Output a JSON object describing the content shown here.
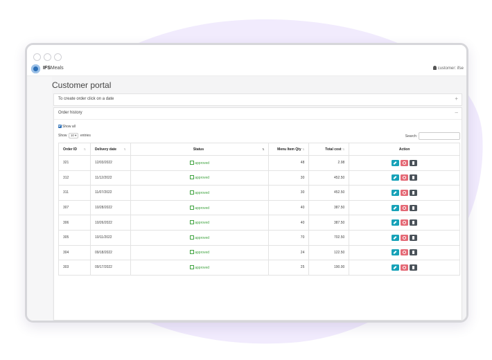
{
  "app": {
    "brand_strong": "IFS",
    "brand_rest": "Meals",
    "user": "customer: ifse"
  },
  "page": {
    "title": "Customer portal"
  },
  "create_card": {
    "title": "To create order click on a date",
    "tool": "+"
  },
  "history_card": {
    "title": "Order history",
    "tool": "–",
    "show_all": "Show all",
    "show_prefix": "Show",
    "entries_value": "10",
    "show_suffix": "entries",
    "search_label": "Search:"
  },
  "table": {
    "columns": [
      "Order ID",
      "Delivery date",
      "Status",
      "Menu Item Qty",
      "Total cost",
      "Action"
    ],
    "rows": [
      {
        "id": "321",
        "date": "12/03/2022",
        "status": "approved",
        "qty": "48",
        "cost": "2.98"
      },
      {
        "id": "312",
        "date": "11/12/2022",
        "status": "approved",
        "qty": "30",
        "cost": "452.50"
      },
      {
        "id": "311",
        "date": "11/07/2022",
        "status": "approved",
        "qty": "30",
        "cost": "452.50"
      },
      {
        "id": "307",
        "date": "10/28/2022",
        "status": "approved",
        "qty": "40",
        "cost": "387.50"
      },
      {
        "id": "306",
        "date": "10/26/2022",
        "status": "approved",
        "qty": "40",
        "cost": "387.50"
      },
      {
        "id": "305",
        "date": "10/11/2022",
        "status": "approved",
        "qty": "70",
        "cost": "702.50"
      },
      {
        "id": "304",
        "date": "09/18/2022",
        "status": "approved",
        "qty": "24",
        "cost": "122.50"
      },
      {
        "id": "303",
        "date": "09/17/2022",
        "status": "approved",
        "qty": "25",
        "cost": "190.00"
      }
    ]
  },
  "icons": {
    "edit": "pencil-icon",
    "cancel": "cancel-icon",
    "details": "document-icon",
    "user": "user-icon"
  },
  "colors": {
    "brand": "#2c6fb7",
    "approved": "#3ea23e",
    "edit_button": "#17a2b8",
    "cancel_button": "#e46a76",
    "details_button": "#4b535a"
  }
}
